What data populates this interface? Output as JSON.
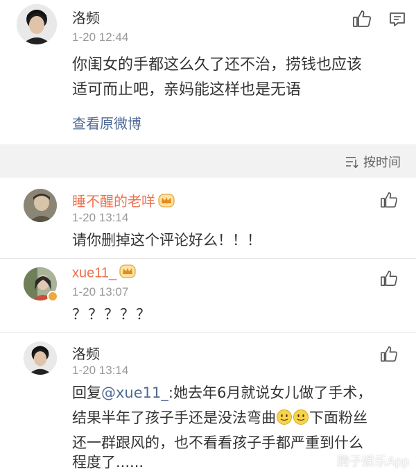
{
  "post": {
    "author": "洛频",
    "time": "1-20 12:44",
    "text_line1": "你闺女的手都这么久了还不治，捞钱也应该",
    "text_line2": "适可而止吧，亲妈能这样也是无语",
    "view_original": "查看原微博"
  },
  "sort": {
    "label": "按时间"
  },
  "comments": [
    {
      "author": "睡不醒的老咩",
      "time": "1-20 13:14",
      "text": "请你删掉这个评论好么！！！"
    },
    {
      "author": "xue11_",
      "time": "1-20 13:07",
      "text": "？？？？？"
    },
    {
      "author": "洛频",
      "time": "1-20 13:14",
      "reply_prefix": "回复",
      "mention": "@xue11_",
      "line1_rest": ":她去年6月就说女儿做了手术，",
      "line2_a": "结果半年了孩子手还是没法弯曲",
      "line2_b": "下面粉丝",
      "line3": "还一群跟风的，也不看看孩子手都严重到什么",
      "line4": "程度了......"
    }
  ],
  "watermark": "腾子娱乐App",
  "colors": {
    "orange_name": "#eb7350",
    "blue_name": "#2e6aa8",
    "link": "#506a94",
    "band": "#f2f2f2"
  }
}
